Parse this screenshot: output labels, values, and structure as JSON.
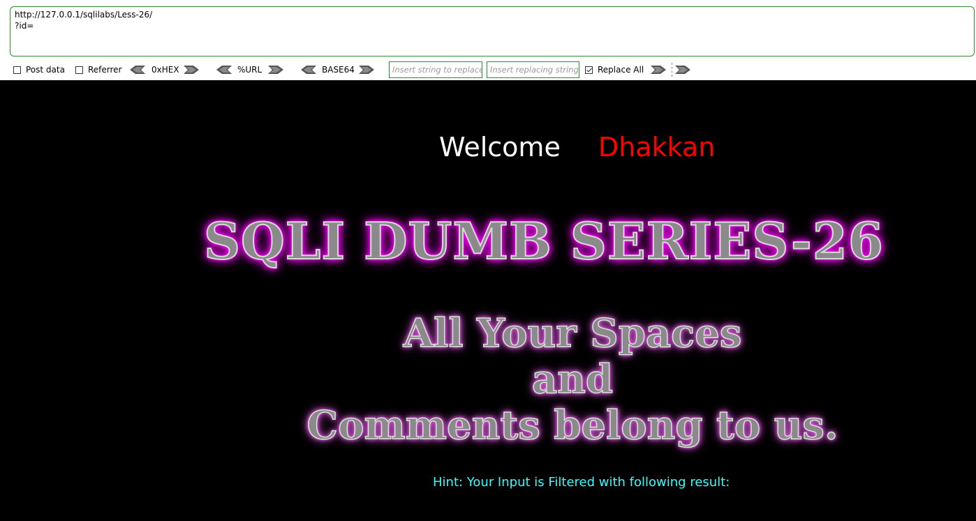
{
  "url_bar": {
    "line1": "http://127.0.0.1/sqlilabs/Less-26/",
    "line2": "?id="
  },
  "options": {
    "post_data": {
      "label": "Post data",
      "checked": false
    },
    "referrer": {
      "label": "Referrer",
      "checked": false
    },
    "hex_label": "0xHEX",
    "url_label": "%URL",
    "base64_label": "BASE64",
    "replace_search_placeholder": "Insert string to replace",
    "replace_with_placeholder": "Insert replacing string",
    "replace_all": {
      "label": "Replace All",
      "checked": true
    }
  },
  "page": {
    "welcome": "Welcome",
    "name": "Dhakkan",
    "series_title": "SQLI DUMB SERIES-26",
    "subtitle_line1": "All Your Spaces",
    "subtitle_line2": "and",
    "subtitle_line3": "Comments belong to us.",
    "hint": "Hint: Your Input is Filtered with following result:"
  },
  "colors": {
    "accent_green": "#2e8b2e",
    "welcome": "#ffffff",
    "name": "#ff0000",
    "glow": "#ff00ff",
    "hint": "#33ffff"
  }
}
